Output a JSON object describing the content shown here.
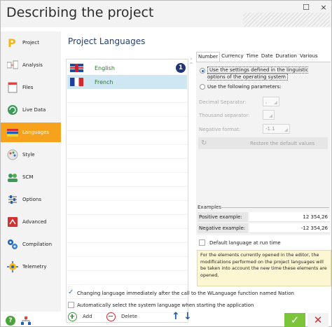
{
  "window": {
    "title": "Describing the project",
    "min_glyph": "☐",
    "close_glyph": "×"
  },
  "sidebar": {
    "items": [
      {
        "label": "Project",
        "icon": "project-icon"
      },
      {
        "label": "Analysis",
        "icon": "analysis-icon"
      },
      {
        "label": "Files",
        "icon": "files-icon"
      },
      {
        "label": "Live Data",
        "icon": "live-data-icon"
      },
      {
        "label": "Languages",
        "icon": "languages-icon",
        "selected": true
      },
      {
        "label": "Style",
        "icon": "style-icon"
      },
      {
        "label": "SCM",
        "icon": "scm-icon"
      },
      {
        "label": "Options",
        "icon": "options-icon"
      },
      {
        "label": "Advanced",
        "icon": "advanced-icon"
      },
      {
        "label": "Compilation",
        "icon": "compilation-icon"
      },
      {
        "label": "Telemetry",
        "icon": "telemetry-icon"
      }
    ]
  },
  "main": {
    "title": "Project Languages",
    "languages": [
      {
        "name": "English",
        "badge": "1"
      },
      {
        "name": "French"
      }
    ],
    "add_label": "Add",
    "delete_label": "Delete",
    "changing_lang_text": "Changing language immediately after the call to the WLanguage function named Nation",
    "auto_select_text": "Automatically select the system language when starting the application"
  },
  "tabs": [
    "Number",
    "Currency",
    "Time",
    "Date",
    "Duration",
    "Various"
  ],
  "number_tab": {
    "option1": "Use the settings defined in the linguistic options of the operating system",
    "option2": "Use the following parameters:",
    "decimal_label": "Decimal Separator:",
    "decimal_value": ",",
    "thousand_label": "Thousand separator:",
    "thousand_value": "",
    "negative_label": "Negative format:",
    "negative_value": "-1.1",
    "restore_label": "Restore the default values"
  },
  "examples": {
    "title": "Examples",
    "positive_label": "Positive example:",
    "positive_value": "12 354,26",
    "negative_label": "Negative example:",
    "negative_value": "-12 354,26"
  },
  "default_lang_label": "Default language at run time",
  "note": "For the elements currently opened in the editor, the modifications performed on the project languages will be taken into account the new time these elements are opened.",
  "footer": {
    "help": "?",
    "ok": "✓",
    "cancel": "✕"
  },
  "colors": {
    "accent": "#f7a21d",
    "title": "#253f6e",
    "ok": "#7cc43a",
    "cancel": "#d62d2d"
  }
}
